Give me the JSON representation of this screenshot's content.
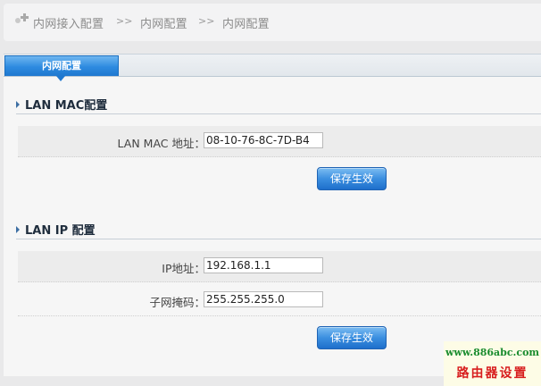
{
  "breadcrumb": {
    "items": [
      "内网接入配置",
      "内网配置",
      "内网配置"
    ],
    "separator": ">>"
  },
  "tab": {
    "label": "内网配置"
  },
  "mac_section": {
    "title": "LAN MAC配置",
    "mac_label": "LAN MAC 地址：",
    "mac_value": "08-10-76-8C-7D-B4",
    "save_label": "保存生效"
  },
  "ip_section": {
    "title": "LAN IP 配置",
    "ip_label": "IP地址：",
    "ip_value": "192.168.1.1",
    "mask_label": "子网掩码：",
    "mask_value": "255.255.255.0",
    "save_label": "保存生效"
  },
  "watermark": {
    "url": "www.886abc.com",
    "caption": "路由器设置"
  },
  "colors": {
    "accent": "#2d8ae0",
    "watermark_url": "#1a8c2e",
    "watermark_caption": "#d81e1e"
  }
}
